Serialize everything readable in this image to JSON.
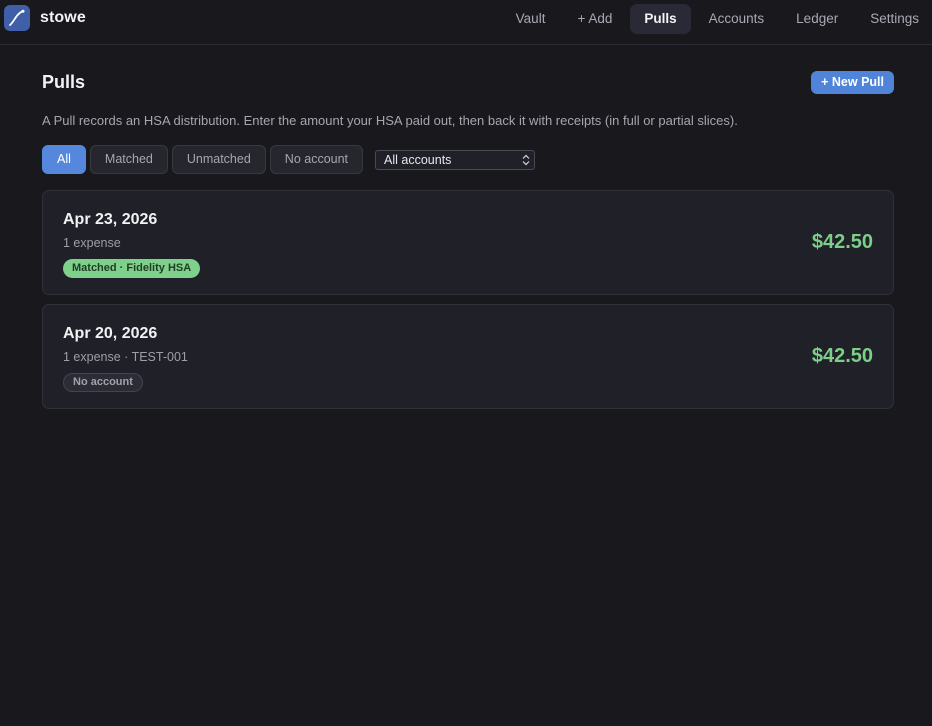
{
  "app": {
    "name": "stowe"
  },
  "nav": {
    "items": [
      {
        "label": "Vault"
      },
      {
        "label": "+ Add"
      },
      {
        "label": "Pulls",
        "active": true
      },
      {
        "label": "Accounts"
      },
      {
        "label": "Ledger"
      },
      {
        "label": "Settings"
      }
    ]
  },
  "page": {
    "title": "Pulls",
    "new_button": "+ New Pull",
    "description": "A Pull records an HSA distribution. Enter the amount your HSA paid out, then back it with receipts (in full or partial slices)."
  },
  "filters": {
    "chips": [
      {
        "label": "All",
        "active": true
      },
      {
        "label": "Matched"
      },
      {
        "label": "Unmatched"
      },
      {
        "label": "No account"
      }
    ],
    "account_select": "All accounts"
  },
  "pulls": [
    {
      "date": "Apr 23, 2026",
      "sub": "1 expense",
      "badge": "Matched · Fidelity HSA",
      "badge_type": "matched",
      "amount": "$42.50"
    },
    {
      "date": "Apr 20, 2026",
      "sub": "1 expense · TEST-001",
      "badge": "No account",
      "badge_type": "none",
      "amount": "$42.50"
    }
  ],
  "colors": {
    "accent": "#5588dc",
    "amount_green": "#7ccf86",
    "matched_badge": "#7ed08a",
    "background": "#18181d"
  }
}
